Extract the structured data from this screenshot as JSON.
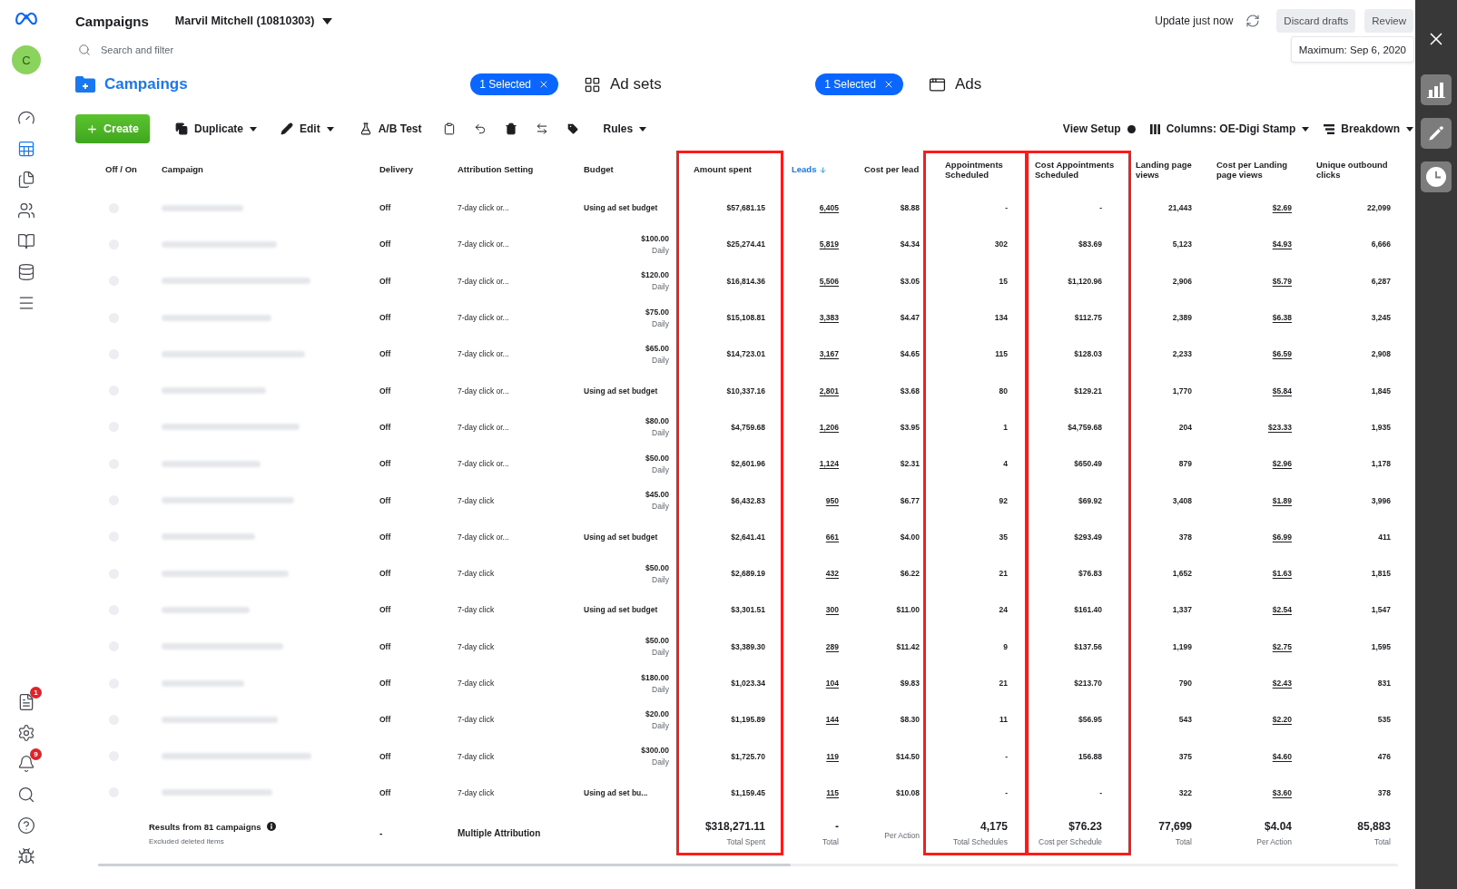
{
  "header": {
    "title": "Campaigns",
    "account": "Marvil Mitchell (10810303)",
    "search": {
      "placeholder": "Search and filter"
    },
    "update_status": "Update just now",
    "buttons": [
      "Discard drafts",
      "Review"
    ],
    "tooltip": "Maximum: Sep 6, 2020"
  },
  "sidebar": {
    "avatar": "C",
    "top_items": [
      {
        "selected": false
      },
      {
        "selected": true
      },
      {
        "selected": false
      },
      {
        "selected": false
      },
      {
        "selected": false
      },
      {
        "selected": false
      },
      {
        "selected": false
      }
    ],
    "bottom_items": [
      {
        "selected": false,
        "badge": "1"
      },
      {
        "selected": false
      },
      {
        "selected": false,
        "badge": "9"
      },
      {
        "selected": false
      },
      {
        "selected": false
      },
      {
        "selected": false
      }
    ]
  },
  "levels": [
    {
      "label": "Campaings",
      "selected": true,
      "selection": "1 Selected"
    },
    {
      "label": "Ad sets",
      "selected": false,
      "selection": "1 Selected"
    },
    {
      "label": "Ads",
      "selected": false
    }
  ],
  "toolbar": {
    "create": "Create",
    "actions": [
      {
        "label": "Duplicate",
        "menu": true
      },
      {
        "label": "Edit",
        "menu": true
      },
      {
        "label": "A/B Test",
        "menu": false
      }
    ],
    "rules": {
      "label": "Rules",
      "menu": true
    },
    "view_setup": "View Setup",
    "columns": {
      "label": "Columns: OE-Digi Stamp",
      "menu": true
    },
    "breakdown": {
      "label": "Breakdown",
      "menu": true
    }
  },
  "table": {
    "columns": [
      {
        "label": "Off / On",
        "sorted": false
      },
      {
        "label": "Campaign",
        "sorted": false
      },
      {
        "label": "Delivery",
        "sorted": false
      },
      {
        "label": "Attribution Setting",
        "sorted": false
      },
      {
        "label": "Budget",
        "sorted": false
      },
      {
        "label": "Amount spent",
        "highlighted": true,
        "sorted": false
      },
      {
        "label": "Leads",
        "sorted": true,
        "linked": true
      },
      {
        "label": "Cost per lead",
        "sorted": false
      },
      {
        "label": "Appointments Scheduled",
        "highlighted": true,
        "sorted": false
      },
      {
        "label": "Cost Appointments Scheduled",
        "highlighted": true,
        "sorted": false
      },
      {
        "label": "Landing page views",
        "sorted": false
      },
      {
        "label": "Cost per Landing page views",
        "sorted": false,
        "linked": true
      },
      {
        "label": "Unique outbound clicks",
        "sorted": false
      }
    ],
    "rows": [
      {
        "on": false,
        "delivery": "Off",
        "attribution": "7-day click or...",
        "budget": {
          "kind": "shared",
          "text": "Using ad set budget"
        },
        "metrics": [
          "$57,681.15",
          "6,405",
          "$8.88",
          "-",
          "-",
          "21,443",
          "$2.69",
          "22,099"
        ]
      },
      {
        "on": false,
        "delivery": "Off",
        "attribution": "7-day click or...",
        "budget": {
          "kind": "amount",
          "amount": "$100.00",
          "period": "Daily"
        },
        "metrics": [
          "$25,274.41",
          "5,819",
          "$4.34",
          "302",
          "$83.69",
          "5,123",
          "$4.93",
          "6,666"
        ]
      },
      {
        "on": false,
        "delivery": "Off",
        "attribution": "7-day click or...",
        "budget": {
          "kind": "amount",
          "amount": "$120.00",
          "period": "Daily"
        },
        "metrics": [
          "$16,814.36",
          "5,506",
          "$3.05",
          "15",
          "$1,120.96",
          "2,906",
          "$5.79",
          "6,287"
        ]
      },
      {
        "on": false,
        "delivery": "Off",
        "attribution": "7-day click or...",
        "budget": {
          "kind": "amount",
          "amount": "$75.00",
          "period": "Daily"
        },
        "metrics": [
          "$15,108.81",
          "3,383",
          "$4.47",
          "134",
          "$112.75",
          "2,389",
          "$6.38",
          "3,245"
        ]
      },
      {
        "on": false,
        "delivery": "Off",
        "attribution": "7-day click or...",
        "budget": {
          "kind": "amount",
          "amount": "$65.00",
          "period": "Daily"
        },
        "metrics": [
          "$14,723.01",
          "3,167",
          "$4.65",
          "115",
          "$128.03",
          "2,233",
          "$6.59",
          "2,908"
        ]
      },
      {
        "on": false,
        "delivery": "Off",
        "attribution": "7-day click or...",
        "budget": {
          "kind": "shared",
          "text": "Using ad set budget"
        },
        "metrics": [
          "$10,337.16",
          "2,801",
          "$3.68",
          "80",
          "$129.21",
          "1,770",
          "$5.84",
          "1,845"
        ]
      },
      {
        "on": false,
        "delivery": "Off",
        "attribution": "7-day click or...",
        "budget": {
          "kind": "amount",
          "amount": "$80.00",
          "period": "Daily"
        },
        "metrics": [
          "$4,759.68",
          "1,206",
          "$3.95",
          "1",
          "$4,759.68",
          "204",
          "$23.33",
          "1,935"
        ]
      },
      {
        "on": false,
        "delivery": "Off",
        "attribution": "7-day click or...",
        "budget": {
          "kind": "amount",
          "amount": "$50.00",
          "period": "Daily"
        },
        "metrics": [
          "$2,601.96",
          "1,124",
          "$2.31",
          "4",
          "$650.49",
          "879",
          "$2.96",
          "1,178"
        ]
      },
      {
        "on": false,
        "delivery": "Off",
        "attribution": "7-day click",
        "budget": {
          "kind": "amount",
          "amount": "$45.00",
          "period": "Daily"
        },
        "metrics": [
          "$6,432.83",
          "950",
          "$6.77",
          "92",
          "$69.92",
          "3,408",
          "$1.89",
          "3,996"
        ]
      },
      {
        "on": false,
        "delivery": "Off",
        "attribution": "7-day click or...",
        "budget": {
          "kind": "shared",
          "text": "Using ad set budget"
        },
        "metrics": [
          "$2,641.41",
          "661",
          "$4.00",
          "35",
          "$293.49",
          "378",
          "$6.99",
          "411"
        ]
      },
      {
        "on": false,
        "delivery": "Off",
        "attribution": "7-day click",
        "budget": {
          "kind": "amount",
          "amount": "$50.00",
          "period": "Daily"
        },
        "metrics": [
          "$2,689.19",
          "432",
          "$6.22",
          "21",
          "$76.83",
          "1,652",
          "$1.63",
          "1,815"
        ]
      },
      {
        "on": false,
        "delivery": "Off",
        "attribution": "7-day click",
        "budget": {
          "kind": "shared",
          "text": "Using ad set budget"
        },
        "metrics": [
          "$3,301.51",
          "300",
          "$11.00",
          "24",
          "$161.40",
          "1,337",
          "$2.54",
          "1,547"
        ]
      },
      {
        "on": false,
        "delivery": "Off",
        "attribution": "7-day click",
        "budget": {
          "kind": "amount",
          "amount": "$50.00",
          "period": "Daily"
        },
        "metrics": [
          "$3,389.30",
          "289",
          "$11.42",
          "9",
          "$137.56",
          "1,199",
          "$2.75",
          "1,595"
        ]
      },
      {
        "on": false,
        "delivery": "Off",
        "attribution": "7-day click",
        "budget": {
          "kind": "amount",
          "amount": "$180.00",
          "period": "Daily"
        },
        "metrics": [
          "$1,023.34",
          "104",
          "$9.83",
          "21",
          "$213.70",
          "790",
          "$2.43",
          "831"
        ]
      },
      {
        "on": false,
        "delivery": "Off",
        "attribution": "7-day click",
        "budget": {
          "kind": "amount",
          "amount": "$20.00",
          "period": "Daily"
        },
        "metrics": [
          "$1,195.89",
          "144",
          "$8.30",
          "11",
          "$56.95",
          "543",
          "$2.20",
          "535"
        ]
      },
      {
        "on": false,
        "delivery": "Off",
        "attribution": "7-day click",
        "budget": {
          "kind": "amount",
          "amount": "$300.00",
          "period": "Daily"
        },
        "metrics": [
          "$1,725.70",
          "119",
          "$14.50",
          "-",
          "156.88",
          "375",
          "$4.60",
          "476"
        ]
      },
      {
        "on": false,
        "delivery": "Off",
        "attribution": "7-day click",
        "budget": {
          "kind": "shared",
          "text": "Using ad set bu..."
        },
        "metrics": [
          "$1,159.45",
          "115",
          "$10.08",
          "-",
          "-",
          "322",
          "$3.60",
          "378"
        ]
      }
    ],
    "footer": {
      "summary": "Results from 81 campaigns",
      "note": "Excluded deleted items",
      "delivery": "-",
      "attribution": "Multiple Attribution",
      "metrics": [
        {
          "value": "$318,271.11",
          "label": "Total Spent"
        },
        {
          "value": "-",
          "label": "Total"
        },
        {
          "label": "Per Action"
        },
        {
          "value": "4,175",
          "label": "Total Schedules"
        },
        {
          "value": "$76.23",
          "label": "Cost per Schedule"
        },
        {
          "value": "77,699",
          "label": "Total"
        },
        {
          "value": "$4.04",
          "label": "Per Action"
        },
        {
          "value": "85,883",
          "label": "Total"
        }
      ]
    }
  }
}
